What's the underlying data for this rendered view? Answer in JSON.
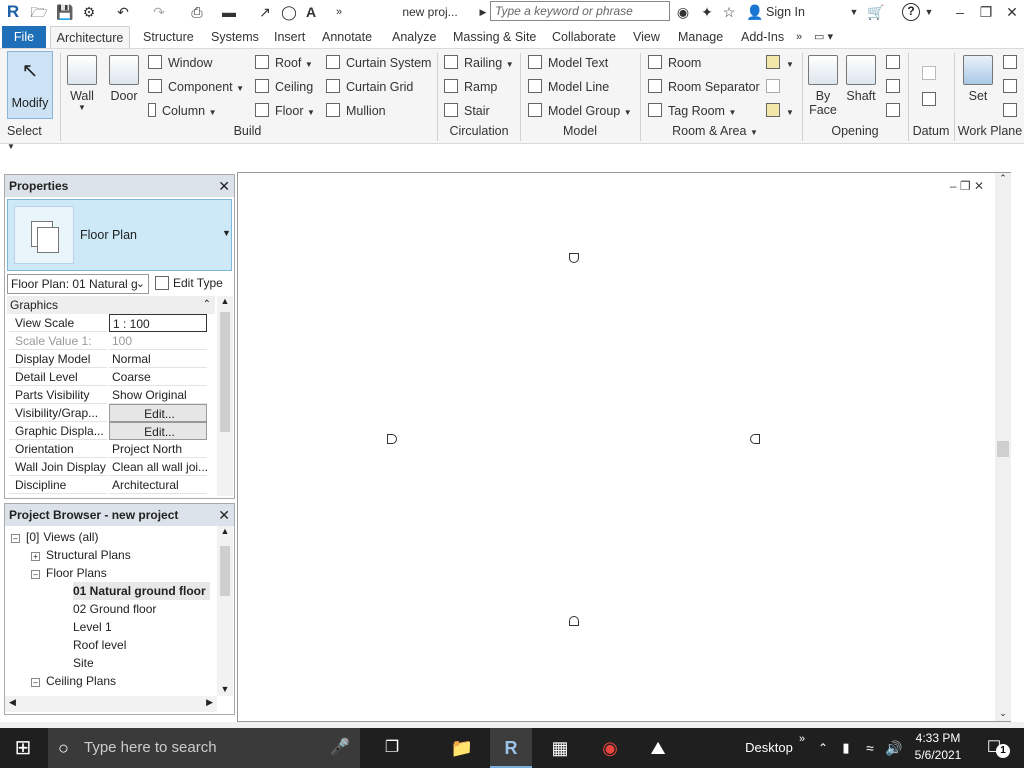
{
  "qat": {
    "app_icon": "R",
    "project_title": "new proj...",
    "search_placeholder": "Type a keyword or phrase",
    "sign_in": "Sign In",
    "help": "?"
  },
  "tabs": [
    "File",
    "Architecture",
    "Structure",
    "Systems",
    "Insert",
    "Annotate",
    "Analyze",
    "Massing & Site",
    "Collaborate",
    "View",
    "Manage",
    "Add-Ins"
  ],
  "ribbon": {
    "modify": "Modify",
    "select": "Select",
    "build": {
      "wall": "Wall",
      "door": "Door",
      "window": "Window",
      "component": "Component",
      "column": "Column",
      "roof": "Roof",
      "ceiling": "Ceiling",
      "floor": "Floor",
      "curtain_system": "Curtain System",
      "curtain_grid": "Curtain Grid",
      "mullion": "Mullion",
      "panel": "Build"
    },
    "circulation": {
      "railing": "Railing",
      "ramp": "Ramp",
      "stair": "Stair",
      "panel": "Circulation"
    },
    "model": {
      "model_text": "Model Text",
      "model_line": "Model Line",
      "model_group": "Model Group",
      "panel": "Model"
    },
    "room_area": {
      "room": "Room",
      "room_separator": "Room Separator",
      "tag_room": "Tag Room",
      "panel": "Room & Area"
    },
    "opening": {
      "by_face": "By Face",
      "by_face_line1": "By",
      "by_face_line2": "Face",
      "shaft": "Shaft",
      "panel": "Opening"
    },
    "datum": {
      "panel": "Datum"
    },
    "work_plane": {
      "set": "Set",
      "panel": "Work Plane"
    }
  },
  "properties": {
    "title": "Properties",
    "type_name": "Floor Plan",
    "instance_selector": "Floor Plan: 01 Natural g",
    "edit_type": "Edit Type",
    "group": "Graphics",
    "rows": [
      {
        "label": "View Scale",
        "value": "1 : 100"
      },
      {
        "label": "Scale Value    1:",
        "value": "100"
      },
      {
        "label": "Display Model",
        "value": "Normal"
      },
      {
        "label": "Detail Level",
        "value": "Coarse"
      },
      {
        "label": "Parts Visibility",
        "value": "Show Original"
      },
      {
        "label": "Visibility/Grap...",
        "value": "Edit..."
      },
      {
        "label": "Graphic Displa...",
        "value": "Edit..."
      },
      {
        "label": "Orientation",
        "value": "Project North"
      },
      {
        "label": "Wall Join Display",
        "value": "Clean all wall joi..."
      },
      {
        "label": "Discipline",
        "value": "Architectural"
      }
    ]
  },
  "browser": {
    "title": "Project Browser - new project",
    "views_all": "Views (all)",
    "structural_plans": "Structural Plans",
    "floor_plans": "Floor Plans",
    "items": [
      "01 Natural ground floor",
      "02 Ground floor",
      "Level 1",
      "Roof level",
      "Site"
    ],
    "ceiling_plans": "Ceiling Plans"
  },
  "taskbar": {
    "search_placeholder": "Type here to search",
    "desktop": "Desktop",
    "time": "4:33 PM",
    "date": "5/6/2021",
    "notification_count": "1"
  }
}
